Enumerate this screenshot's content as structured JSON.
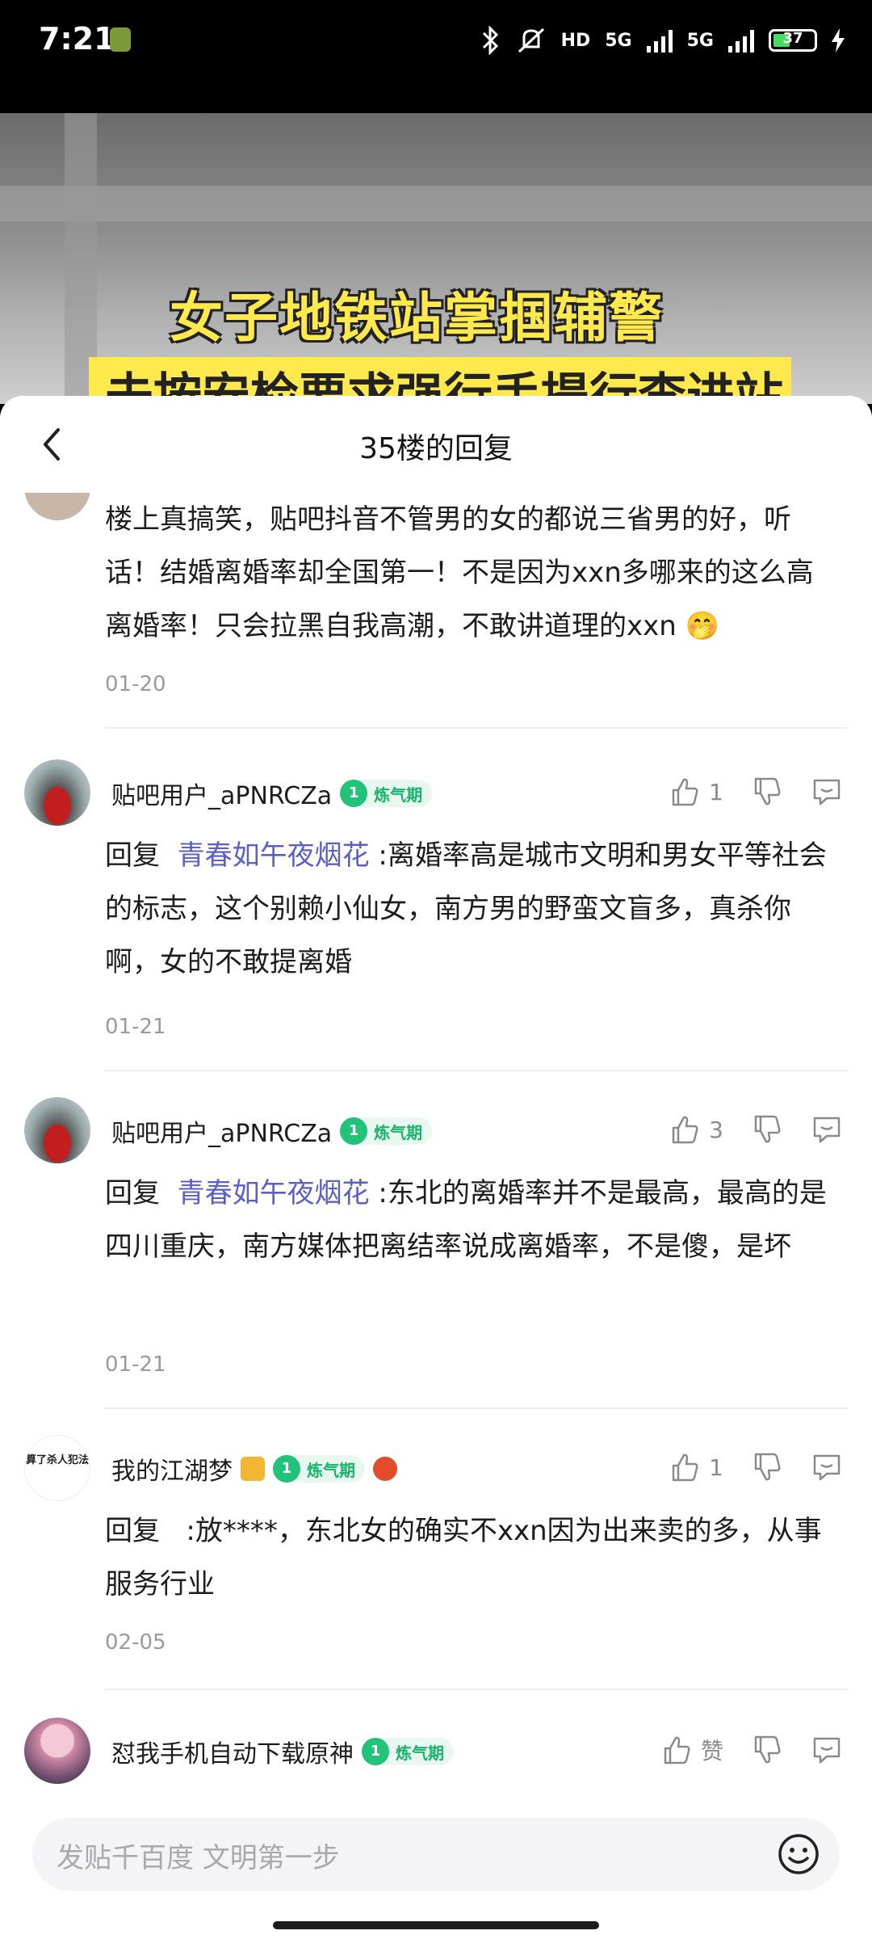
{
  "status_bar": {
    "time": "7:21",
    "hd": "HD",
    "net1": "5G",
    "net2": "5G",
    "battery": "37"
  },
  "video": {
    "caption_line1": "女子地铁站掌掴辅警",
    "caption_line2": "未按安检要求强行手提行李进站"
  },
  "sheet": {
    "title": "35楼的回复"
  },
  "first_comment": {
    "text": "楼上真搞笑，贴吧抖音不管男的女的都说三省男的好，听话！结婚离婚率却全国第一！不是因为xxn多哪来的这么高离婚率！只会拉黑自我高潮，不敢讲道理的xxn 🤭",
    "date": "01-20"
  },
  "comments": [
    {
      "user": "贴吧用户_aPNRCZa",
      "level_num": "1",
      "level": "炼气期",
      "likes": "1",
      "reply_prefix": "回复",
      "reply_to": "青春如午夜烟花",
      "text": " :离婚率高是城市文明和男女平等社会的标志，这个别赖小仙女，南方男的野蛮文盲多，真杀你啊，女的不敢提离婚",
      "date": "01-21"
    },
    {
      "user": "贴吧用户_aPNRCZa",
      "level_num": "1",
      "level": "炼气期",
      "likes": "3",
      "reply_prefix": "回复",
      "reply_to": "青春如午夜烟花",
      "text": " :东北的离婚率并不是最高，最高的是四川重庆，南方媒体把离结率说成离婚率，不是傻，是坏",
      "date": "01-21"
    },
    {
      "user": "我的江湖梦",
      "avatar_text": "算了杀人犯法",
      "level_num": "1",
      "level": "炼气期",
      "likes": "1",
      "reply_prefix": "回复",
      "reply_to": "",
      "text": " :放****，东北女的确实不xxn因为出来卖的多，从事服务行业",
      "date": "02-05"
    },
    {
      "user": "怼我手机自动下载原神",
      "level_num": "1",
      "level": "炼气期",
      "likes": "赞"
    }
  ],
  "input": {
    "placeholder": "发贴千百度 文明第一步"
  }
}
